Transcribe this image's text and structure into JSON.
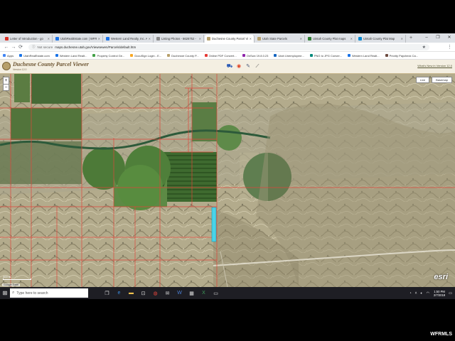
{
  "browser": {
    "tabs": [
      {
        "label": "Letter of Introduction - go",
        "color": "#d93025",
        "active": false
      },
      {
        "label": "UtahRealEstate.com | WFR",
        "color": "#1a73e8",
        "active": false
      },
      {
        "label": "Western Land Realty, Inc. A",
        "color": "#1a73e8",
        "active": false
      },
      {
        "label": "Listing Photos - 6626752 -",
        "color": "#888888",
        "active": false
      },
      {
        "label": "Duchesne County Parcel Vi",
        "color": "#b7a06b",
        "active": true
      },
      {
        "label": "Utah State Parcels",
        "color": "#b7a06b",
        "active": false
      },
      {
        "label": "Uintah County Plat maps",
        "color": "#2e7d32",
        "active": false
      },
      {
        "label": "Uintah County Plat Map",
        "color": "#0288d1",
        "active": false
      }
    ],
    "new_tab_glyph": "+",
    "window_controls": [
      "–",
      "❐",
      "✕"
    ],
    "secure_label": "Not secure",
    "url": "maps.duchesne.utah.gov/Viewsewen/Parcels/default.htm",
    "bookmarks": [
      {
        "label": "Apps",
        "color": "#4285f4"
      },
      {
        "label": "UtahRealEstate.com",
        "color": "#1a73e8"
      },
      {
        "label": "Western Land Realt...",
        "color": "#1a73e8"
      },
      {
        "label": "Property Control Ge...",
        "color": "#43a047"
      },
      {
        "label": "DocuSign Login - E...",
        "color": "#f9a825"
      },
      {
        "label": "Duchesne County P...",
        "color": "#b7a06b"
      },
      {
        "label": "Online PDF Convert...",
        "color": "#e53935"
      },
      {
        "label": "OnSwx 19.8.0.23",
        "color": "#8e24aa"
      },
      {
        "label": "Utah Unemployme...",
        "color": "#1565c0"
      },
      {
        "label": "PNG to JPG Conver...",
        "color": "#00897b"
      },
      {
        "label": "Western Land Realt...",
        "color": "#1a73e8"
      },
      {
        "label": "Priority Paycheck Ca...",
        "color": "#6d4c41"
      }
    ]
  },
  "app": {
    "title": "Duchesne County Parcel Viewer",
    "version": "Version 12.0",
    "whats_new": "What's New in Version 12.0",
    "map_buttons": [
      "Live",
      "Basemap"
    ],
    "zoom_in": "+",
    "zoom_out": "−",
    "esri_logo": "esri",
    "attribution": "Google Earth",
    "scale_label": "300 m",
    "colors": {
      "header_bg": "#f4efe2",
      "title": "#6b5330",
      "parcel_lines": "#e0453a",
      "selected_parcel": "#49d3e8"
    }
  },
  "taskbar": {
    "search_placeholder": "Type here to search",
    "clock_time": "1:50 PM",
    "clock_date": "2/7/2019",
    "icons": [
      "task-view-icon",
      "edge-icon",
      "file-explorer-icon",
      "store-icon",
      "chrome-icon",
      "mail-icon",
      "word-icon",
      "calculator-icon",
      "excel-icon",
      "terminal-icon"
    ]
  },
  "watermark": "WFRMLS"
}
